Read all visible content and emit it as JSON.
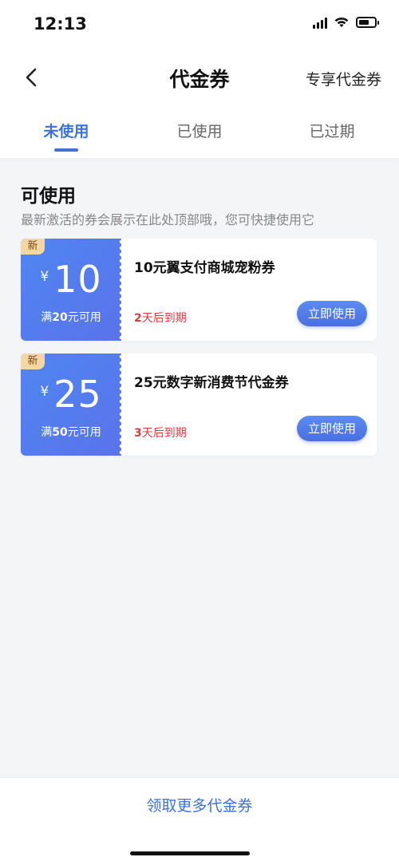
{
  "status_bar": {
    "time": "12:13"
  },
  "header": {
    "title": "代金券",
    "right_link": "专享代金券"
  },
  "tabs": [
    {
      "label": "未使用",
      "active": true
    },
    {
      "label": "已使用",
      "active": false
    },
    {
      "label": "已过期",
      "active": false
    }
  ],
  "section": {
    "title": "可使用",
    "subtitle": "最新激活的券会展示在此处顶部哦，您可快捷使用它"
  },
  "coupons": [
    {
      "tag": "新",
      "currency": "¥",
      "amount": "10",
      "condition_prefix": "满",
      "condition_value": "20",
      "condition_suffix": "元可用",
      "name": "10元翼支付商城宠粉券",
      "expiry_days": "2",
      "expiry_suffix": "天后到期",
      "button": "立即使用"
    },
    {
      "tag": "新",
      "currency": "¥",
      "amount": "25",
      "condition_prefix": "满",
      "condition_value": "50",
      "condition_suffix": "元可用",
      "name": "25元数字新消费节代金券",
      "expiry_days": "3",
      "expiry_suffix": "天后到期",
      "button": "立即使用"
    }
  ],
  "footer": {
    "more_link": "领取更多代金券"
  },
  "icons": [
    "chevron-left-icon",
    "signal-icon",
    "wifi-icon",
    "battery-icon"
  ],
  "colors": {
    "accent": "#3e72d9",
    "coupon_gradient_start": "#4f86f2",
    "expiry_red": "#e0393e",
    "tag_gold": "#f5d7a3"
  }
}
